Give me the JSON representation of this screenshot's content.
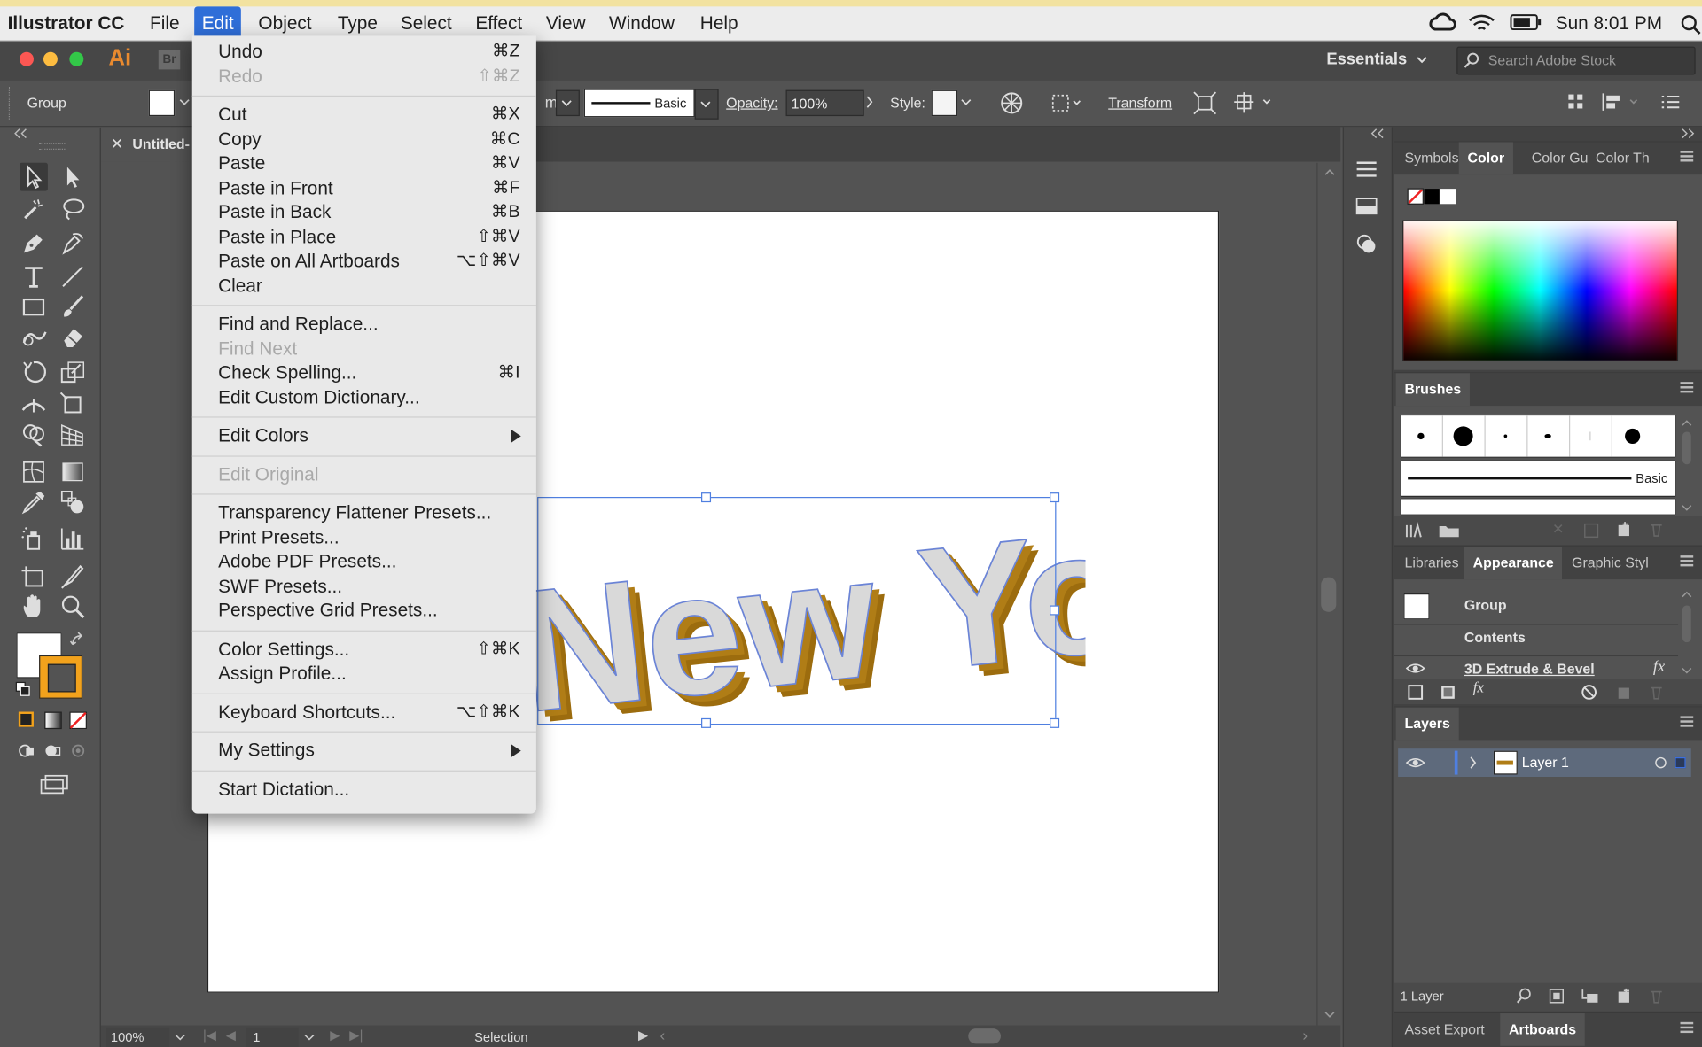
{
  "mac_menu": {
    "app_name": "Illustrator CC",
    "items": [
      "File",
      "Edit",
      "Object",
      "Type",
      "Select",
      "Effect",
      "View",
      "Window",
      "Help"
    ],
    "active": "Edit",
    "clock": "Sun 8:01 PM"
  },
  "app_bar": {
    "logo": "Ai",
    "bridge": "Br",
    "workspace": "Essentials",
    "search_placeholder": "Search Adobe Stock"
  },
  "control_bar": {
    "selection_type": "Group",
    "stroke_style": "Basic",
    "opacity_label": "Opacity:",
    "opacity_value": "100%",
    "style_label": "Style:",
    "transform": "Transform",
    "partial_text": "m"
  },
  "document": {
    "tab_title": "Untitled-",
    "artwork_text": "New York",
    "zoom": "100%",
    "artboard_number": "1",
    "status": "Selection"
  },
  "edit_menu": {
    "groups": [
      [
        {
          "label": "Undo",
          "shortcut": "⌘Z",
          "enabled": true
        },
        {
          "label": "Redo",
          "shortcut": "⇧⌘Z",
          "enabled": false
        }
      ],
      [
        {
          "label": "Cut",
          "shortcut": "⌘X",
          "enabled": true
        },
        {
          "label": "Copy",
          "shortcut": "⌘C",
          "enabled": true
        },
        {
          "label": "Paste",
          "shortcut": "⌘V",
          "enabled": true
        },
        {
          "label": "Paste in Front",
          "shortcut": "⌘F",
          "enabled": true
        },
        {
          "label": "Paste in Back",
          "shortcut": "⌘B",
          "enabled": true
        },
        {
          "label": "Paste in Place",
          "shortcut": "⇧⌘V",
          "enabled": true
        },
        {
          "label": "Paste on All Artboards",
          "shortcut": "⌥⇧⌘V",
          "enabled": true
        },
        {
          "label": "Clear",
          "shortcut": "",
          "enabled": true
        }
      ],
      [
        {
          "label": "Find and Replace...",
          "shortcut": "",
          "enabled": true
        },
        {
          "label": "Find Next",
          "shortcut": "",
          "enabled": false
        },
        {
          "label": "Check Spelling...",
          "shortcut": "⌘I",
          "enabled": true
        },
        {
          "label": "Edit Custom Dictionary...",
          "shortcut": "",
          "enabled": true
        }
      ],
      [
        {
          "label": "Edit Colors",
          "shortcut": "",
          "enabled": true,
          "submenu": true
        }
      ],
      [
        {
          "label": "Edit Original",
          "shortcut": "",
          "enabled": false
        }
      ],
      [
        {
          "label": "Transparency Flattener Presets...",
          "shortcut": "",
          "enabled": true
        },
        {
          "label": "Print Presets...",
          "shortcut": "",
          "enabled": true
        },
        {
          "label": "Adobe PDF Presets...",
          "shortcut": "",
          "enabled": true
        },
        {
          "label": "SWF Presets...",
          "shortcut": "",
          "enabled": true
        },
        {
          "label": "Perspective Grid Presets...",
          "shortcut": "",
          "enabled": true
        }
      ],
      [
        {
          "label": "Color Settings...",
          "shortcut": "⇧⌘K",
          "enabled": true
        },
        {
          "label": "Assign Profile...",
          "shortcut": "",
          "enabled": true
        }
      ],
      [
        {
          "label": "Keyboard Shortcuts...",
          "shortcut": "⌥⇧⌘K",
          "enabled": true
        }
      ],
      [
        {
          "label": "My Settings",
          "shortcut": "",
          "enabled": true,
          "submenu": true
        }
      ],
      [
        {
          "label": "Start Dictation...",
          "shortcut": "",
          "enabled": true
        }
      ]
    ]
  },
  "panels": {
    "color_tabs": [
      "Symbols",
      "Color",
      "Color Gu",
      "Color Th"
    ],
    "color_active": "Color",
    "brushes_title": "Brushes",
    "brush_basic": "Basic",
    "appearance_tabs": [
      "Libraries",
      "Appearance",
      "Graphic Styl"
    ],
    "appearance_active": "Appearance",
    "appearance_rows": [
      "Group",
      "Contents",
      "3D Extrude & Bevel"
    ],
    "fx_label": "fx",
    "layers_title": "Layers",
    "layer_name": "Layer 1",
    "layer_count": "1 Layer",
    "bottom_tabs": [
      "Asset Export",
      "Artboards"
    ],
    "bottom_active": "Artboards"
  },
  "colors": {
    "accent_blue": "#2f6ed8",
    "selection_blue": "#4f7fe0",
    "extrude_gold": "#b07d16",
    "stroke_orange": "#f2a21c"
  }
}
